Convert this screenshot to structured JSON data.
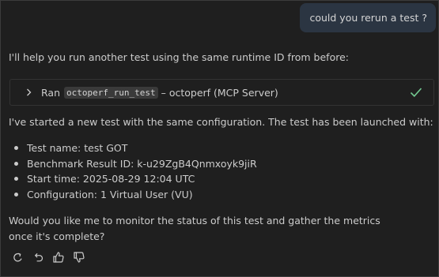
{
  "user_message": "could you rerun a test ?",
  "assistant": {
    "intro": "I'll help you run another test using the same runtime ID from before:",
    "tool_call": {
      "prefix": "Ran",
      "tool_name": "octoperf_run_test",
      "suffix": "– octoperf (MCP Server)",
      "status_icon": "check-icon",
      "status_color": "#73c991"
    },
    "status_text": "I've started a new test with the same configuration. The test has been launched with:",
    "details": [
      "Test name: test GOT",
      "Benchmark Result ID: k-u29ZgB4Qnmxoyk9jiR",
      "Start time: 2025-08-29 12:04 UTC",
      "Configuration: 1 Virtual User (VU)"
    ],
    "question": "Would you like me to monitor the status of this test and gather the metrics once it's complete?"
  },
  "actions": [
    {
      "name": "retry",
      "icon": "retry-icon"
    },
    {
      "name": "undo",
      "icon": "undo-icon"
    },
    {
      "name": "thumbs-up",
      "icon": "thumbs-up-icon"
    },
    {
      "name": "thumbs-down",
      "icon": "thumbs-down-icon"
    }
  ],
  "colors": {
    "background": "#1f1f1f",
    "user_bubble": "#2b3542",
    "text": "#cccccc",
    "success": "#73c991"
  }
}
